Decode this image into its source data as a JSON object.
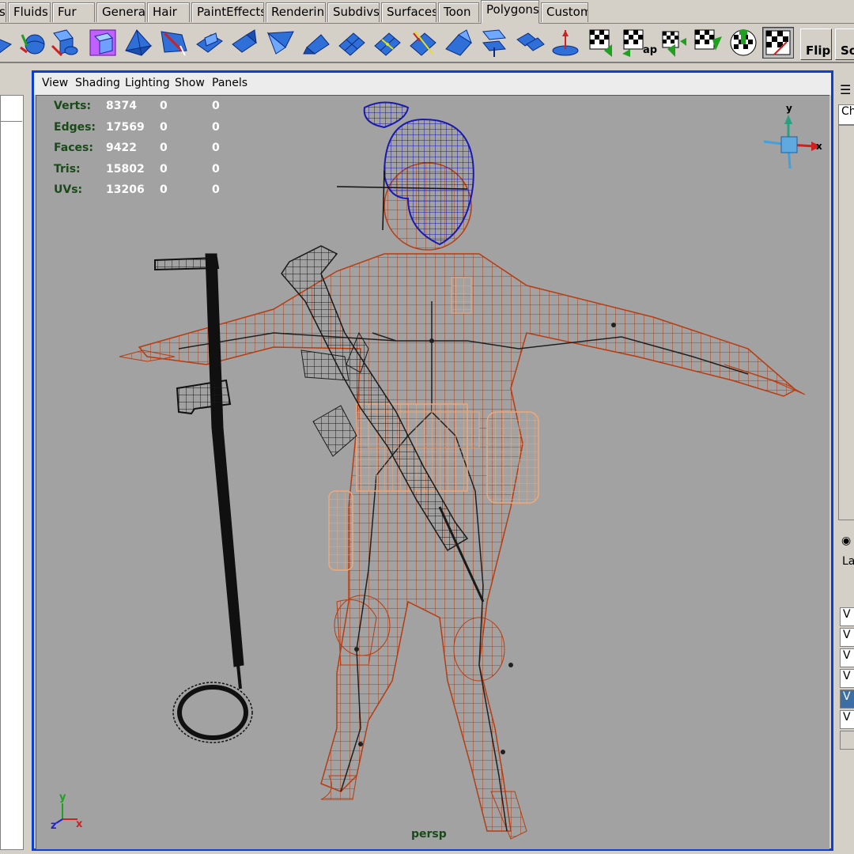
{
  "shelf_tabs": [
    {
      "label": "s",
      "active": false
    },
    {
      "label": "Fluids",
      "active": false
    },
    {
      "label": "Fur",
      "active": false
    },
    {
      "label": "General",
      "active": false
    },
    {
      "label": "Hair",
      "active": false
    },
    {
      "label": "PaintEffects",
      "active": false
    },
    {
      "label": "Rendering",
      "active": false
    },
    {
      "label": "Subdivs",
      "active": false
    },
    {
      "label": "Surfaces",
      "active": false
    },
    {
      "label": "Toon",
      "active": false
    },
    {
      "label": "Polygons",
      "active": true
    },
    {
      "label": "Custom",
      "active": false
    }
  ],
  "shelf_buttons": {
    "map_label": "ap",
    "flip_label": "Flip",
    "so_label": "So"
  },
  "panel_menu": [
    "View",
    "Shading",
    "Lighting",
    "Show",
    "Panels"
  ],
  "hud": {
    "rows": [
      {
        "label": "Verts:",
        "v1": "8374",
        "v2": "0",
        "v3": "0"
      },
      {
        "label": "Edges:",
        "v1": "17569",
        "v2": "0",
        "v3": "0"
      },
      {
        "label": "Faces:",
        "v1": "9422",
        "v2": "0",
        "v3": "0"
      },
      {
        "label": "Tris:",
        "v1": "15802",
        "v2": "0",
        "v3": "0"
      },
      {
        "label": "UVs:",
        "v1": "13206",
        "v2": "0",
        "v3": "0"
      }
    ]
  },
  "camera": "persp",
  "view_cube": {
    "y": "y",
    "x": "x"
  },
  "axis": {
    "y": "y",
    "z": "z",
    "x": "x"
  },
  "right_panel": {
    "channel_tab": "Ch",
    "layer_tab": "La",
    "layer_items": [
      "V",
      "V",
      "V",
      "V",
      "V",
      "V"
    ]
  },
  "colors": {
    "selection": "#0a3fd7",
    "viewport_bg": "#a2a2a2",
    "hud_label": "#1a4a1a",
    "wire_body": "#b83c10",
    "wire_hair": "#1a1ab0",
    "wire_gear": "#f0a878",
    "wire_detector": "#101010"
  }
}
